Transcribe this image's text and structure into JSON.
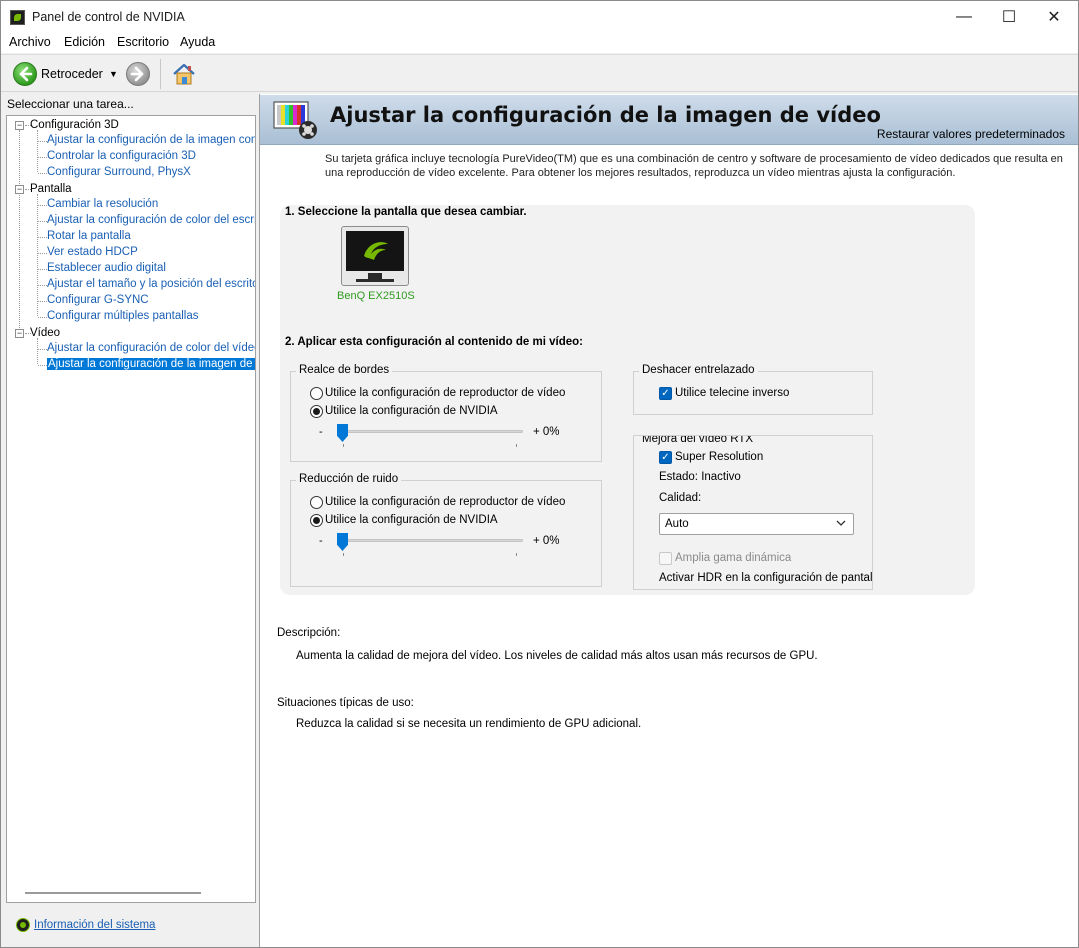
{
  "window": {
    "title": "Panel de control de NVIDIA"
  },
  "menu": [
    "Archivo",
    "Edición",
    "Escritorio",
    "Ayuda"
  ],
  "toolbar": {
    "back_label": "Retroceder"
  },
  "left": {
    "header": "Seleccionar una tarea...",
    "tree": [
      {
        "label": "Configuración 3D",
        "children": [
          "Ajustar la configuración de la imagen con v",
          "Controlar la configuración 3D",
          "Configurar Surround, PhysX"
        ]
      },
      {
        "label": "Pantalla",
        "children": [
          "Cambiar la resolución",
          "Ajustar la configuración de color del escrito",
          "Rotar la pantalla",
          "Ver estado HDCP",
          "Establecer audio digital",
          "Ajustar el tamaño y la posición del escritori",
          "Configurar G-SYNC",
          "Configurar múltiples pantallas"
        ]
      },
      {
        "label": "Vídeo",
        "children": [
          "Ajustar la configuración de color del vídeo",
          "Ajustar la configuración de la imagen de víd"
        ]
      }
    ],
    "system_info": "Información del sistema"
  },
  "main": {
    "title": "Ajustar la configuración de la imagen de vídeo",
    "restore": "Restaurar valores predeterminados",
    "intro": "Su tarjeta gráfica incluye tecnología PureVideo(TM) que es una combinación de centro y software de procesamiento de vídeo dedicados que resulta en una reproducción de vídeo excelente. Para obtener los mejores resultados, reproduzca un vídeo mientras ajusta la configuración.",
    "step1": "1. Seleccione la pantalla que desea cambiar.",
    "display_name": "BenQ EX2510S",
    "step2": "2. Aplicar esta configuración al contenido de mi vídeo:",
    "edge": {
      "title": "Realce de bordes",
      "option_player": "Utilice la configuración de reproductor de vídeo",
      "option_nvidia": "Utilice la configuración de NVIDIA",
      "selected": "nvidia",
      "minus": "-",
      "value_text": "+ 0%",
      "level": 0
    },
    "noise": {
      "title": "Reducción de ruido",
      "option_player": "Utilice la configuración de reproductor de vídeo",
      "option_nvidia": "Utilice la configuración de NVIDIA",
      "selected": "nvidia",
      "minus": "-",
      "value_text": "+ 0%",
      "level": 0
    },
    "deinterlace": {
      "title": "Deshacer entrelazado",
      "checkbox_label": "Utilice telecine inverso",
      "checked": true
    },
    "rtx": {
      "title": "Mejora del vídeo RTX",
      "super_resolution_label": "Super Resolution",
      "super_resolution_checked": true,
      "status_text": "Estado: Inactivo",
      "quality_label": "Calidad:",
      "quality_value": "Auto",
      "hdr_label": "Amplia gama dinámica",
      "hdr_checked": false,
      "hdr_note": "Activar HDR en la configuración de pantalla"
    },
    "description_label": "Descripción:",
    "description_text": "Aumenta la calidad de mejora del vídeo.  Los niveles de calidad más altos usan más recursos de GPU.",
    "usage_label": "Situaciones típicas de uso:",
    "usage_text": "Reduzca la calidad si se necesita un rendimiento de GPU adicional."
  },
  "colors": {
    "accent": "#0078d7",
    "nvidia_green": "#76b900",
    "link": "#1a5fb4",
    "banner": "#b9cbe0"
  }
}
